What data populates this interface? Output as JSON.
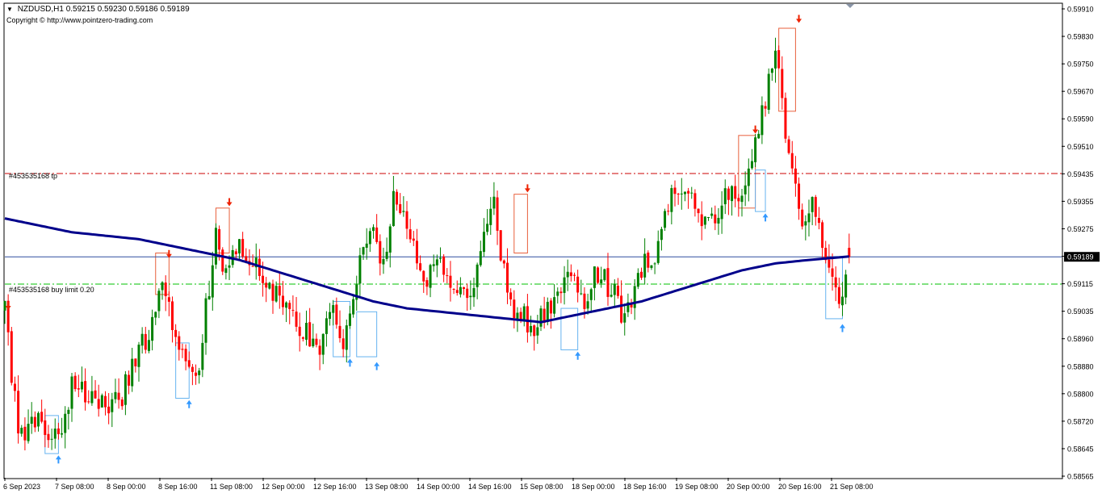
{
  "header": {
    "menu_glyph": "▼",
    "title": "NZDUSD,H1  0.59215 0.59230 0.59186 0.59189",
    "copyright": "Copyright © http://www.pointzero-trading.com"
  },
  "levels": {
    "tp_label": "#453535168 tp",
    "buy_limit_label": "#453535168 buy limit 0.20",
    "current_price_label": "0.59189"
  },
  "colors": {
    "bull": "#008000",
    "bear": "#ff0000",
    "ma": "#00008b",
    "tp_line": "#cc0000",
    "buy_limit_line": "#00c000",
    "current_line": "#2f4f9f",
    "buy_arrow": "#3399ff",
    "sell_arrow": "#ee2200"
  },
  "chart_data": {
    "type": "candlestick",
    "symbol": "NZDUSD",
    "timeframe": "H1",
    "ohlc_last": {
      "open": 0.59215,
      "high": 0.5923,
      "low": 0.59186,
      "close": 0.59189
    },
    "ylim": [
      0.5855,
      0.5992
    ],
    "y_ticks": [
      "0.59910",
      "0.59830",
      "0.59750",
      "0.59670",
      "0.59590",
      "0.59510",
      "0.59435",
      "0.59355",
      "0.59275",
      "0.59195",
      "0.59115",
      "0.59035",
      "0.58960",
      "0.58880",
      "0.58800",
      "0.58720",
      "0.58645",
      "0.58565"
    ],
    "x_ticks": [
      "6 Sep 2023",
      "7 Sep 08:00",
      "8 Sep 00:00",
      "8 Sep 16:00",
      "11 Sep 08:00",
      "12 Sep 00:00",
      "12 Sep 16:00",
      "13 Sep 08:00",
      "14 Sep 00:00",
      "14 Sep 16:00",
      "15 Sep 08:00",
      "18 Sep 00:00",
      "18 Sep 16:00",
      "19 Sep 08:00",
      "20 Sep 00:00",
      "20 Sep 16:00",
      "21 Sep 08:00"
    ],
    "close_path": [
      [
        0,
        0.5903
      ],
      [
        4,
        0.5868
      ],
      [
        10,
        0.5871
      ],
      [
        16,
        0.5866
      ],
      [
        20,
        0.5882
      ],
      [
        26,
        0.5879
      ],
      [
        34,
        0.5876
      ],
      [
        38,
        0.5888
      ],
      [
        44,
        0.5899
      ],
      [
        47,
        0.5911
      ],
      [
        50,
        0.5901
      ],
      [
        53,
        0.589
      ],
      [
        57,
        0.5881
      ],
      [
        60,
        0.5904
      ],
      [
        63,
        0.5925
      ],
      [
        66,
        0.5914
      ],
      [
        70,
        0.5922
      ],
      [
        74,
        0.5919
      ],
      [
        78,
        0.5912
      ],
      [
        82,
        0.5906
      ],
      [
        86,
        0.59
      ],
      [
        90,
        0.5897
      ],
      [
        94,
        0.5893
      ],
      [
        98,
        0.5904
      ],
      [
        101,
        0.5895
      ],
      [
        104,
        0.5908
      ],
      [
        107,
        0.592
      ],
      [
        110,
        0.5928
      ],
      [
        113,
        0.5916
      ],
      [
        116,
        0.5936
      ],
      [
        119,
        0.5931
      ],
      [
        122,
        0.5921
      ],
      [
        126,
        0.5913
      ],
      [
        130,
        0.5918
      ],
      [
        134,
        0.591
      ],
      [
        137,
        0.5908
      ],
      [
        140,
        0.5912
      ],
      [
        143,
        0.5923
      ],
      [
        146,
        0.5933
      ],
      [
        149,
        0.5914
      ],
      [
        152,
        0.5904
      ],
      [
        155,
        0.5902
      ],
      [
        158,
        0.5896
      ],
      [
        161,
        0.5903
      ],
      [
        164,
        0.5906
      ],
      [
        167,
        0.5911
      ],
      [
        170,
        0.5912
      ],
      [
        173,
        0.5902
      ],
      [
        176,
        0.5915
      ],
      [
        179,
        0.5912
      ],
      [
        182,
        0.5908
      ],
      [
        185,
        0.5901
      ],
      [
        188,
        0.5911
      ],
      [
        191,
        0.5918
      ],
      [
        194,
        0.592
      ],
      [
        197,
        0.593
      ],
      [
        200,
        0.5938
      ],
      [
        203,
        0.594
      ],
      [
        206,
        0.5933
      ],
      [
        209,
        0.5928
      ],
      [
        212,
        0.5931
      ],
      [
        215,
        0.5938
      ],
      [
        218,
        0.5935
      ],
      [
        221,
        0.594
      ],
      [
        224,
        0.595
      ],
      [
        227,
        0.5965
      ],
      [
        230,
        0.5982
      ],
      [
        232,
        0.5962
      ],
      [
        235,
        0.5945
      ],
      [
        238,
        0.5925
      ],
      [
        241,
        0.5935
      ],
      [
        244,
        0.5922
      ],
      [
        247,
        0.591
      ],
      [
        250,
        0.5908
      ],
      [
        252,
        0.5919
      ]
    ],
    "ma_path": [
      [
        0,
        0.593
      ],
      [
        10,
        0.5928
      ],
      [
        20,
        0.5926
      ],
      [
        30,
        0.5925
      ],
      [
        40,
        0.5924
      ],
      [
        50,
        0.5922
      ],
      [
        60,
        0.592
      ],
      [
        70,
        0.5918
      ],
      [
        80,
        0.5915
      ],
      [
        90,
        0.5912
      ],
      [
        100,
        0.5909
      ],
      [
        110,
        0.5906
      ],
      [
        120,
        0.5904
      ],
      [
        130,
        0.5903
      ],
      [
        140,
        0.5902
      ],
      [
        150,
        0.5901
      ],
      [
        160,
        0.59
      ],
      [
        170,
        0.5902
      ],
      [
        180,
        0.5904
      ],
      [
        190,
        0.5906
      ],
      [
        200,
        0.5909
      ],
      [
        210,
        0.5912
      ],
      [
        220,
        0.5915
      ],
      [
        230,
        0.5917
      ],
      [
        240,
        0.5918
      ],
      [
        252,
        0.5919
      ]
    ],
    "zones_sell": [
      [
        45,
        49,
        0.5908,
        0.592
      ],
      [
        63,
        67,
        0.592,
        0.5933
      ],
      [
        152,
        156,
        0.592,
        0.5937
      ],
      [
        219,
        224,
        0.5933,
        0.5954
      ],
      [
        231,
        236,
        0.5961,
        0.5985
      ]
    ],
    "zones_buy": [
      [
        12,
        16,
        0.5862,
        0.5873
      ],
      [
        51,
        55,
        0.5878,
        0.5894
      ],
      [
        98,
        103,
        0.589,
        0.5906
      ],
      [
        105,
        111,
        0.589,
        0.5903
      ],
      [
        166,
        171,
        0.5892,
        0.5904
      ],
      [
        224,
        227,
        0.5932,
        0.5944
      ],
      [
        245,
        250,
        0.5901,
        0.5919
      ]
    ],
    "sell_arrows": [
      [
        1,
        0.5904
      ],
      [
        49,
        0.5919
      ],
      [
        67,
        0.5934
      ],
      [
        156,
        0.5938
      ],
      [
        224,
        0.5955
      ],
      [
        237,
        0.5987
      ]
    ],
    "buy_arrows": [
      [
        16,
        0.5861
      ],
      [
        55,
        0.5877
      ],
      [
        103,
        0.5889
      ],
      [
        111,
        0.5888
      ],
      [
        171,
        0.5891
      ],
      [
        227,
        0.5931
      ],
      [
        250,
        0.5899
      ]
    ],
    "hlines": {
      "tp": 0.5943,
      "buy_limit": 0.5911,
      "current": 0.59189
    }
  }
}
